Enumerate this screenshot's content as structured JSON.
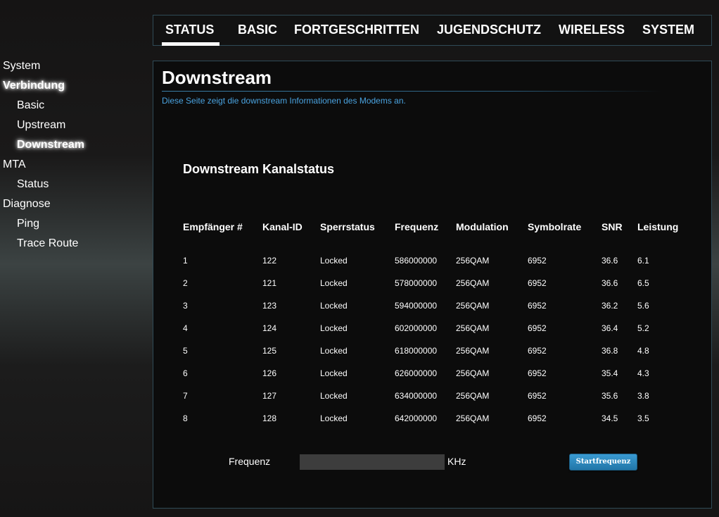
{
  "topnav": {
    "tabs": [
      {
        "label": "STATUS",
        "active": true
      },
      {
        "label": "BASIC",
        "active": false
      },
      {
        "label": "FORTGESCHRITTEN",
        "active": false
      },
      {
        "label": "JUGENDSCHUTZ",
        "active": false
      },
      {
        "label": "WIRELESS",
        "active": false
      },
      {
        "label": "SYSTEM",
        "active": false
      }
    ]
  },
  "sidebar": {
    "items": [
      {
        "label": "System",
        "level": 1
      },
      {
        "label": "Verbindung",
        "level": 1,
        "highlighted": true
      },
      {
        "label": "Basic",
        "level": 2
      },
      {
        "label": "Upstream",
        "level": 2
      },
      {
        "label": "Downstream",
        "level": 2,
        "highlighted": true
      },
      {
        "label": "MTA",
        "level": 1
      },
      {
        "label": "Status",
        "level": 2
      },
      {
        "label": "Diagnose",
        "level": 1
      },
      {
        "label": "Ping",
        "level": 2
      },
      {
        "label": "Trace Route",
        "level": 2
      }
    ]
  },
  "page": {
    "title": "Downstream",
    "description": "Diese Seite zeigt die downstream Informationen des Modems an.",
    "section_title": "Downstream Kanalstatus"
  },
  "table": {
    "columns": [
      "Empfänger #",
      "Kanal-ID",
      "Sperrstatus",
      "Frequenz",
      "Modulation",
      "Symbolrate",
      "SNR",
      "Leistung"
    ],
    "rows": [
      [
        "1",
        "122",
        "Locked",
        "586000000",
        "256QAM",
        "6952",
        "36.6",
        "6.1"
      ],
      [
        "2",
        "121",
        "Locked",
        "578000000",
        "256QAM",
        "6952",
        "36.6",
        "6.5"
      ],
      [
        "3",
        "123",
        "Locked",
        "594000000",
        "256QAM",
        "6952",
        "36.2",
        "5.6"
      ],
      [
        "4",
        "124",
        "Locked",
        "602000000",
        "256QAM",
        "6952",
        "36.4",
        "5.2"
      ],
      [
        "5",
        "125",
        "Locked",
        "618000000",
        "256QAM",
        "6952",
        "36.8",
        "4.8"
      ],
      [
        "6",
        "126",
        "Locked",
        "626000000",
        "256QAM",
        "6952",
        "35.4",
        "4.3"
      ],
      [
        "7",
        "127",
        "Locked",
        "634000000",
        "256QAM",
        "6952",
        "35.6",
        "3.8"
      ],
      [
        "8",
        "128",
        "Locked",
        "642000000",
        "256QAM",
        "6952",
        "34.5",
        "3.5"
      ]
    ]
  },
  "frequency": {
    "label": "Frequenz",
    "value": "",
    "unit": "KHz",
    "button_label": "Startfrequenz"
  },
  "colors": {
    "accent_blue": "#4aa3e0",
    "button_blue": "#2b8ac2",
    "panel_border": "#2f4b57"
  }
}
